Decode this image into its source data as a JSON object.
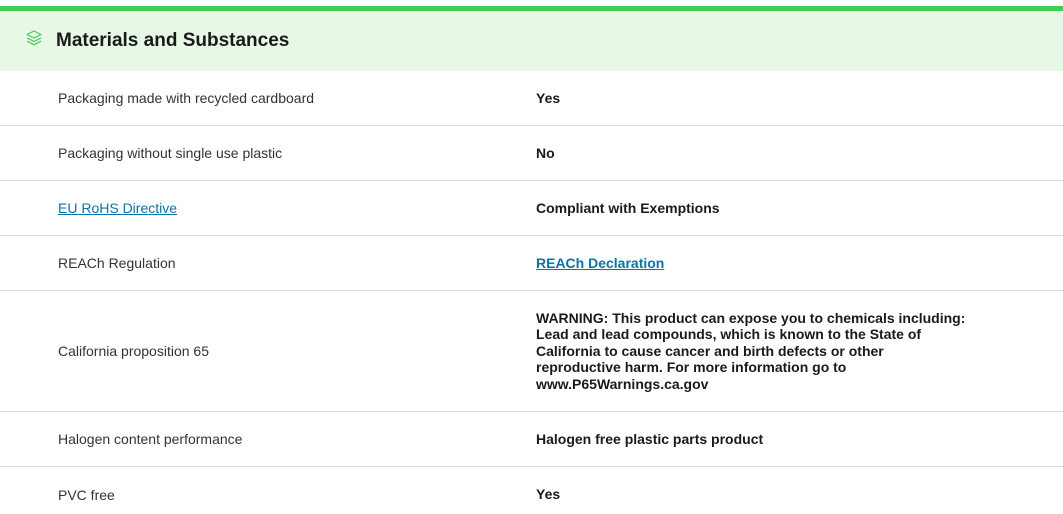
{
  "section": {
    "title": "Materials and Substances",
    "icon": "layers-icon",
    "accent_color": "#3dcd58",
    "header_bg": "#e7f9e6",
    "link_color": "#0a74a8"
  },
  "rows": [
    {
      "label": "Packaging made with recycled cardboard",
      "value": "Yes"
    },
    {
      "label": "Packaging without single use plastic",
      "value": "No"
    },
    {
      "label": "EU RoHS Directive",
      "value": "Compliant with Exemptions"
    },
    {
      "label": "REACh Regulation",
      "value": "REACh Declaration"
    },
    {
      "label": "California proposition 65",
      "value": "WARNING: This product can expose you to chemicals including: Lead and lead compounds, which is known to the State of California to cause cancer and birth defects or other reproductive harm. For more information go to www.P65Warnings.ca.gov"
    },
    {
      "label": "Halogen content performance",
      "value": "Halogen free plastic parts product"
    },
    {
      "label": "PVC free",
      "value": "Yes"
    }
  ]
}
